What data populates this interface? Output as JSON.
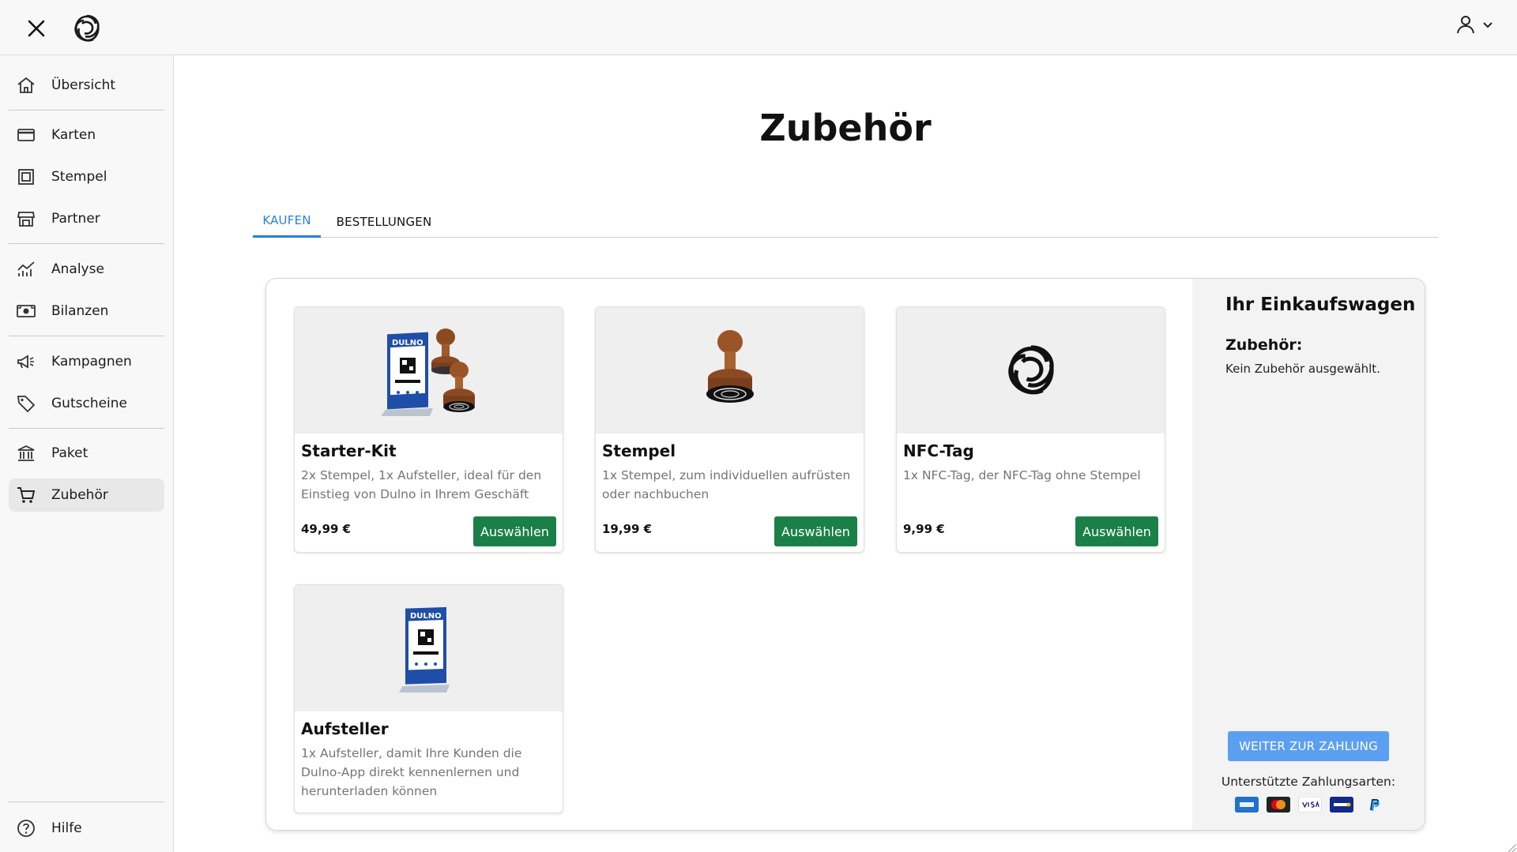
{
  "header": {
    "close_icon": "close-icon",
    "logo_icon": "dulno-logo-icon",
    "user_icon": "user-icon"
  },
  "sidebar": {
    "items": [
      {
        "label": "Übersicht",
        "icon": "home-icon"
      },
      {
        "label": "Karten",
        "icon": "card-icon"
      },
      {
        "label": "Stempel",
        "icon": "stamp-icon"
      },
      {
        "label": "Partner",
        "icon": "store-icon"
      },
      {
        "label": "Analyse",
        "icon": "chart-icon"
      },
      {
        "label": "Bilanzen",
        "icon": "money-icon"
      },
      {
        "label": "Kampagnen",
        "icon": "megaphone-icon"
      },
      {
        "label": "Gutscheine",
        "icon": "tag-icon"
      },
      {
        "label": "Paket",
        "icon": "bank-icon"
      },
      {
        "label": "Zubehör",
        "icon": "cart-icon"
      }
    ],
    "active": "Zubehör",
    "help": {
      "label": "Hilfe",
      "icon": "help-icon"
    }
  },
  "main": {
    "title": "Zubehör",
    "tabs": [
      {
        "label": "KAUFEN",
        "active": true
      },
      {
        "label": "BESTELLUNGEN",
        "active": false
      }
    ]
  },
  "products": [
    {
      "name": "Starter-Kit",
      "desc": "2x Stempel, 1x Aufsteller, ideal für den Einstieg von Dulno in Ihrem Geschäft",
      "price": "49,99 €",
      "button": "Auswählen"
    },
    {
      "name": "Stempel",
      "desc": "1x Stempel, zum individuellen aufrüsten oder nachbuchen",
      "price": "19,99 €",
      "button": "Auswählen"
    },
    {
      "name": "NFC-Tag",
      "desc": "1x NFC-Tag, der NFC-Tag ohne Stempel",
      "price": "9,99 €",
      "button": "Auswählen"
    },
    {
      "name": "Aufsteller",
      "desc": "1x Aufsteller, damit Ihre Kunden die Dulno-App direkt kennenlernen und herunterladen können",
      "price": "",
      "button": ""
    }
  ],
  "product_images": {
    "display_brand": "DULNO"
  },
  "cart": {
    "title": "Ihr Einkaufswagen",
    "subtitle": "Zubehör:",
    "empty_text": "Kein Zubehör ausgewählt.",
    "pay_button": "WEITER ZUR ZAHLUNG",
    "payment_label": "Unterstützte Zahlungsarten:",
    "payment_methods": [
      "AMEX",
      "Mastercard",
      "VISA",
      "SEPA",
      "PayPal"
    ]
  },
  "colors": {
    "accent_blue": "#2a7de1",
    "select_green": "#1b8047",
    "pay_button_blue": "#5b9ff2"
  }
}
